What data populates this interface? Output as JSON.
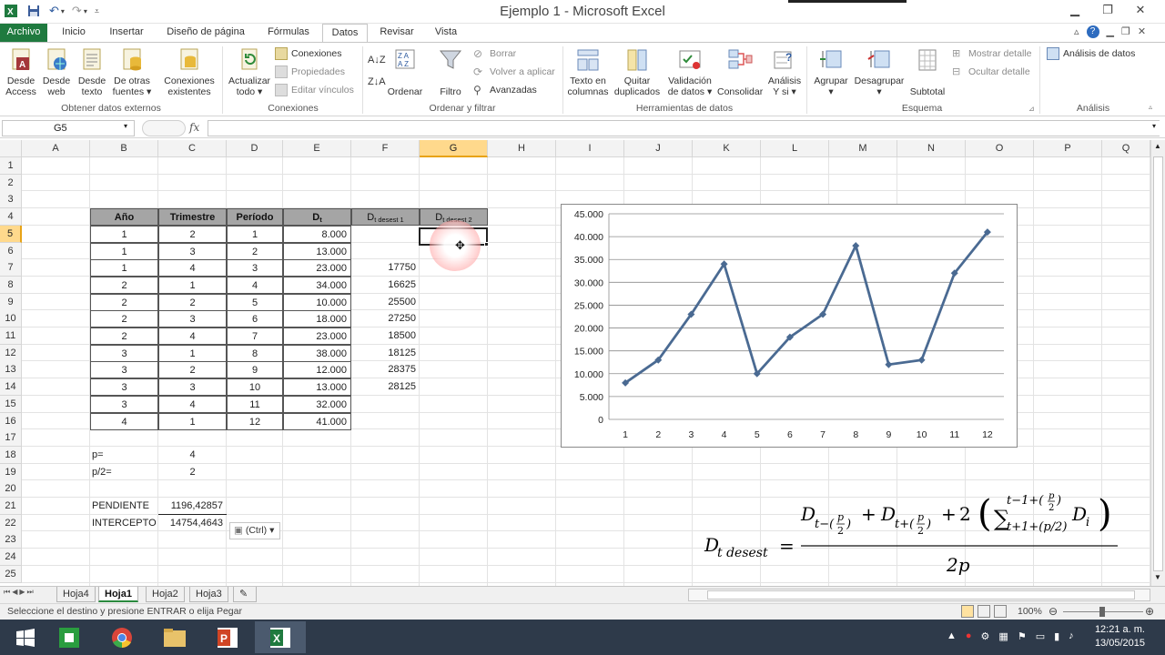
{
  "window": {
    "title": "Ejemplo 1 - Microsoft Excel",
    "minimize": "▁",
    "restore": "❐",
    "close": "✕"
  },
  "tabs": {
    "archivo": "Archivo",
    "inicio": "Inicio",
    "insertar": "Insertar",
    "diseno": "Diseño de página",
    "formulas": "Fórmulas",
    "datos": "Datos",
    "revisar": "Revisar",
    "vista": "Vista"
  },
  "ribbon": {
    "desde_access": [
      "Desde",
      "Access"
    ],
    "desde_web": [
      "Desde",
      "web"
    ],
    "desde_texto": [
      "Desde",
      "texto"
    ],
    "otras_fuentes": [
      "De otras",
      "fuentes ▾"
    ],
    "conexiones_existentes": [
      "Conexiones",
      "existentes"
    ],
    "group_externos": "Obtener datos externos",
    "actualizar": [
      "Actualizar",
      "todo ▾"
    ],
    "conexiones": "Conexiones",
    "propiedades": "Propiedades",
    "editar_vinculos": "Editar vínculos",
    "group_conexiones": "Conexiones",
    "ordenar": "Ordenar",
    "filtro": "Filtro",
    "borrar": "Borrar",
    "volver_aplicar": "Volver a aplicar",
    "avanzadas": "Avanzadas",
    "group_ordenar": "Ordenar y filtrar",
    "texto_columnas": [
      "Texto en",
      "columnas"
    ],
    "quitar_duplicados": [
      "Quitar",
      "duplicados"
    ],
    "validacion": [
      "Validación",
      "de datos ▾"
    ],
    "consolidar": "Consolidar",
    "analisis_si": [
      "Análisis",
      "Y si ▾"
    ],
    "group_herramientas": "Herramientas de datos",
    "agrupar": [
      "Agrupar",
      "▾"
    ],
    "desagrupar": [
      "Desagrupar",
      "▾"
    ],
    "subtotal": "Subtotal",
    "mostrar_detalle": "Mostrar detalle",
    "ocultar_detalle": "Ocultar detalle",
    "group_esquema": "Esquema",
    "analisis_datos": "Análisis de datos",
    "group_analisis": "Análisis"
  },
  "formula_bar": {
    "name_box": "G5",
    "fx": "fx",
    "formula": ""
  },
  "columns": [
    "A",
    "B",
    "C",
    "D",
    "E",
    "F",
    "G",
    "H",
    "I",
    "J",
    "K",
    "L",
    "M",
    "N",
    "O",
    "P",
    "Q"
  ],
  "rows": [
    "1",
    "2",
    "3",
    "4",
    "5",
    "6",
    "7",
    "8",
    "9",
    "10",
    "11",
    "12",
    "13",
    "14",
    "15",
    "16",
    "17",
    "18",
    "19",
    "20",
    "21",
    "22",
    "23",
    "24",
    "25"
  ],
  "table": {
    "headers": [
      "Año",
      "Trimestre",
      "Período"
    ],
    "dt_label": "D",
    "dt_sub": "t",
    "dt1_sub": "t desest 1",
    "dt2_sub": "t desest 2",
    "rows": [
      [
        "1",
        "2",
        "1",
        "8.000",
        ""
      ],
      [
        "1",
        "3",
        "2",
        "13.000",
        ""
      ],
      [
        "1",
        "4",
        "3",
        "23.000",
        "17750"
      ],
      [
        "2",
        "1",
        "4",
        "34.000",
        "16625"
      ],
      [
        "2",
        "2",
        "5",
        "10.000",
        "25500"
      ],
      [
        "2",
        "3",
        "6",
        "18.000",
        "27250"
      ],
      [
        "2",
        "4",
        "7",
        "23.000",
        "18500"
      ],
      [
        "3",
        "1",
        "8",
        "38.000",
        "18125"
      ],
      [
        "3",
        "2",
        "9",
        "12.000",
        "28375"
      ],
      [
        "3",
        "3",
        "10",
        "13.000",
        "28125"
      ],
      [
        "3",
        "4",
        "11",
        "32.000",
        ""
      ],
      [
        "4",
        "1",
        "12",
        "41.000",
        ""
      ]
    ]
  },
  "params": {
    "p_label": "p=",
    "p_value": "4",
    "p2_label": "p/2=",
    "p2_value": "2",
    "pendiente_label": "PENDIENTE",
    "pendiente_value": "1196,42857",
    "intercepto_label": "INTERCEPTO",
    "intercepto_value": "14754,4643",
    "paste_options": "(Ctrl) ▾"
  },
  "chart_data": {
    "type": "line",
    "categories": [
      "1",
      "2",
      "3",
      "4",
      "5",
      "6",
      "7",
      "8",
      "9",
      "10",
      "11",
      "12"
    ],
    "series": [
      {
        "values": [
          8000,
          13000,
          23000,
          34000,
          10000,
          18000,
          23000,
          38000,
          12000,
          13000,
          32000,
          41000
        ]
      }
    ],
    "y_ticks": [
      "0",
      "5.000",
      "10.000",
      "15.000",
      "20.000",
      "25.000",
      "30.000",
      "35.000",
      "40.000",
      "45.000"
    ],
    "ylim": [
      0,
      45000
    ],
    "grid": true,
    "line_color": "#4a6a92"
  },
  "formula_image": {
    "lhs": "D",
    "lhs_sub": "t desest",
    "denominator": "2p"
  },
  "sheets": [
    "Hoja4",
    "Hoja1",
    "Hoja2",
    "Hoja3"
  ],
  "status": {
    "message": "Seleccione el destino y presione ENTRAR o elija Pegar",
    "zoom": "100%"
  },
  "taskbar": {
    "time": "12:21 a. m.",
    "date": "13/05/2015"
  }
}
